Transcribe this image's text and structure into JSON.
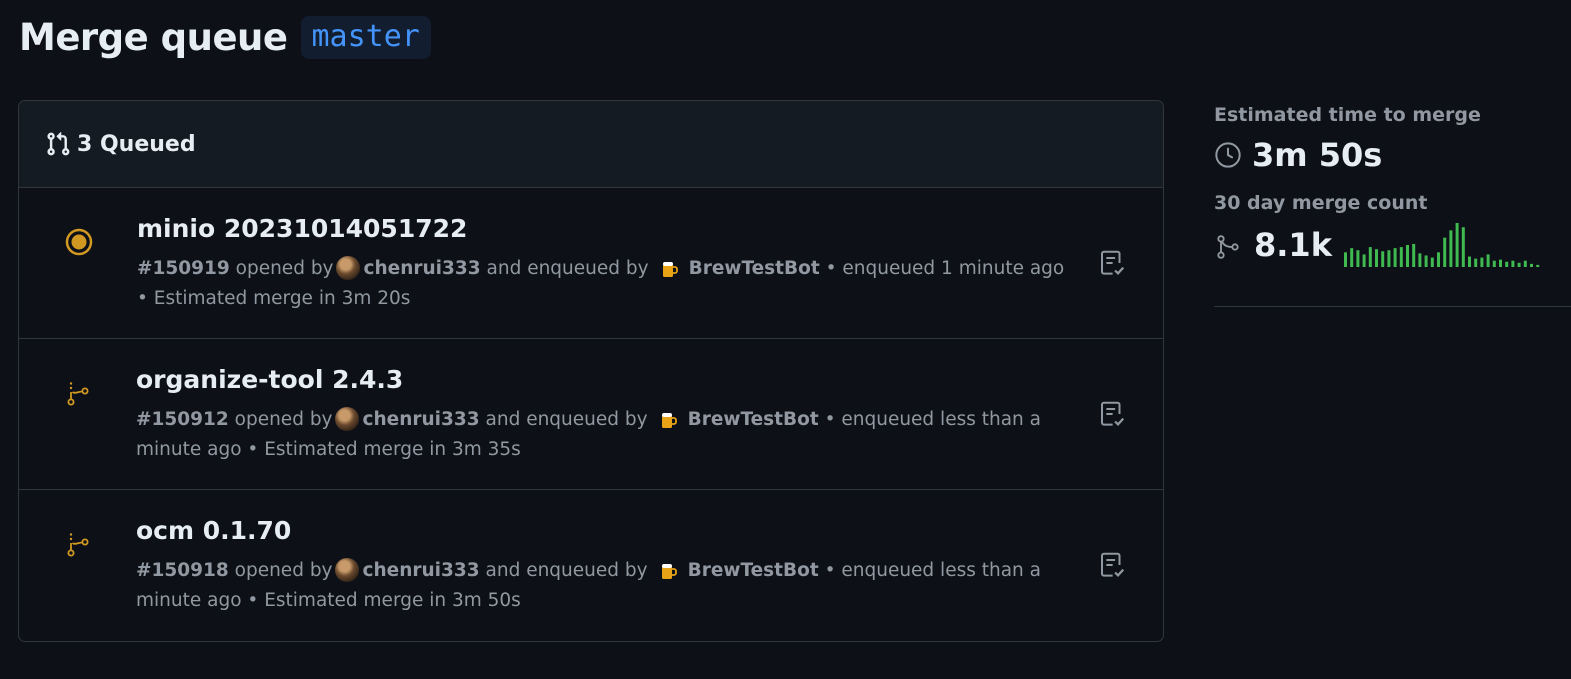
{
  "header": {
    "title": "Merge queue",
    "branch": "master"
  },
  "queue": {
    "count_label": "3 Queued",
    "items": [
      {
        "title": "minio 20231014051722",
        "number": "#150919",
        "opened_by_text": "opened by",
        "author": "chenrui333",
        "enqueued_by_text": "and enqueued by",
        "enqueuer": "BrewTestBot",
        "status_text": "• enqueued 1 minute ago • Estimated merge in 3m 20s",
        "state": "merging"
      },
      {
        "title": "organize-tool 2.4.3",
        "number": "#150912",
        "opened_by_text": "opened by",
        "author": "chenrui333",
        "enqueued_by_text": "and enqueued by",
        "enqueuer": "BrewTestBot",
        "status_text": "• enqueued less than a minute ago • Estimated merge in 3m 35s",
        "state": "queued"
      },
      {
        "title": "ocm 0.1.70",
        "number": "#150918",
        "opened_by_text": "opened by",
        "author": "chenrui333",
        "enqueued_by_text": "and enqueued by",
        "enqueuer": "BrewTestBot",
        "status_text": "• enqueued less than a minute ago • Estimated merge in 3m 50s",
        "state": "queued"
      }
    ]
  },
  "sidebar": {
    "eta_label": "Estimated time to merge",
    "eta_value": "3m 50s",
    "count_label": "30 day merge count",
    "count_value": "8.1k",
    "sparkline_values": [
      14,
      18,
      16,
      12,
      19,
      17,
      15,
      16,
      18,
      19,
      21,
      22,
      13,
      11,
      9,
      14,
      28,
      35,
      42,
      38,
      10,
      8,
      9,
      12,
      6,
      7,
      5,
      6,
      4,
      6,
      3,
      2
    ],
    "sparkline_color": "#3fb950"
  },
  "colors": {
    "accent": "#4493f8",
    "queued": "#d29922",
    "success": "#3fb950"
  },
  "icons": {
    "queue": "git-pull-request-icon",
    "merging": "dot-fill-icon",
    "queued": "git-merge-queue-icon",
    "action": "checklist-icon",
    "eta": "clock-icon",
    "count": "git-merge-icon"
  }
}
